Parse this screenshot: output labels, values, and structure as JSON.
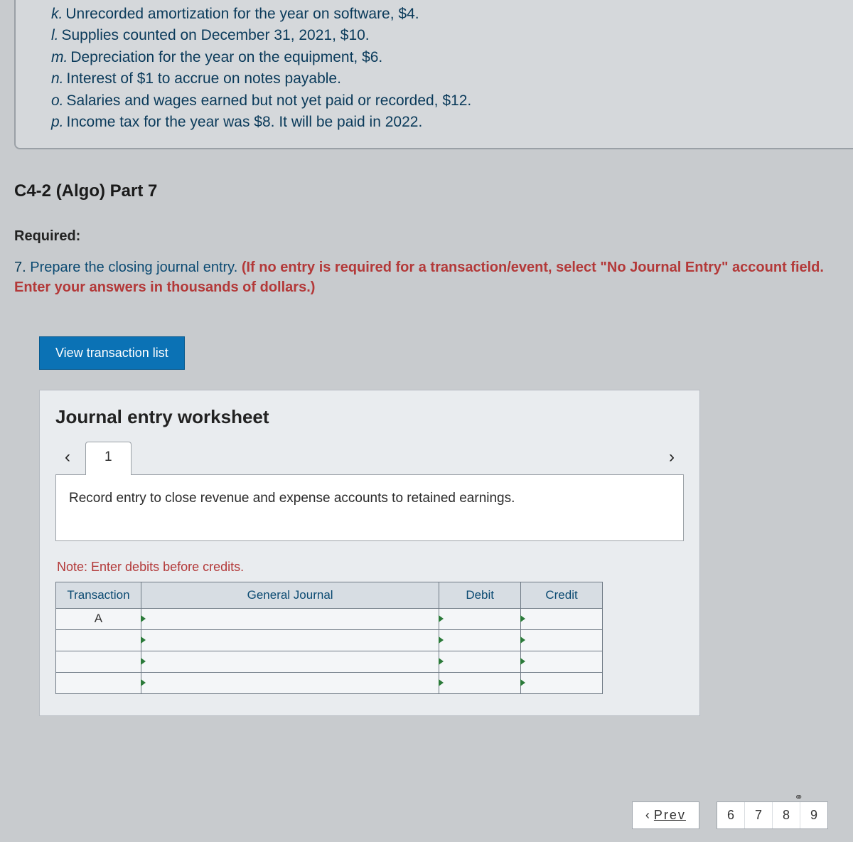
{
  "list": {
    "k": "Unrecorded amortization for the year on software, $4.",
    "l": "Supplies counted on December 31, 2021, $10.",
    "m": "Depreciation for the year on the equipment, $6.",
    "n": "Interest of $1 to accrue on notes payable.",
    "o": "Salaries and wages earned but not yet paid or recorded, $12.",
    "p": "Income tax for the year was $8. It will be paid in 2022."
  },
  "section_title": "C4-2 (Algo) Part 7",
  "required_label": "Required:",
  "instruction": {
    "num": "7.",
    "lead": " Prepare the closing journal entry. ",
    "red": "(If no entry is required for a transaction/event, select \"No Journal Entry\" account field. Enter your answers in thousands of dollars.)"
  },
  "view_btn": "View transaction list",
  "ws_title": "Journal entry worksheet",
  "tab_label": "1",
  "entry_desc": "Record entry to close revenue and expense accounts to retained earnings.",
  "note": "Note: Enter debits before credits.",
  "table": {
    "h_trans": "Transaction",
    "h_gj": "General Journal",
    "h_db": "Debit",
    "h_cr": "Credit",
    "row1_trans": "A"
  },
  "nav": {
    "prev": "Prev",
    "pages": [
      "6",
      "7",
      "8",
      "9"
    ]
  }
}
